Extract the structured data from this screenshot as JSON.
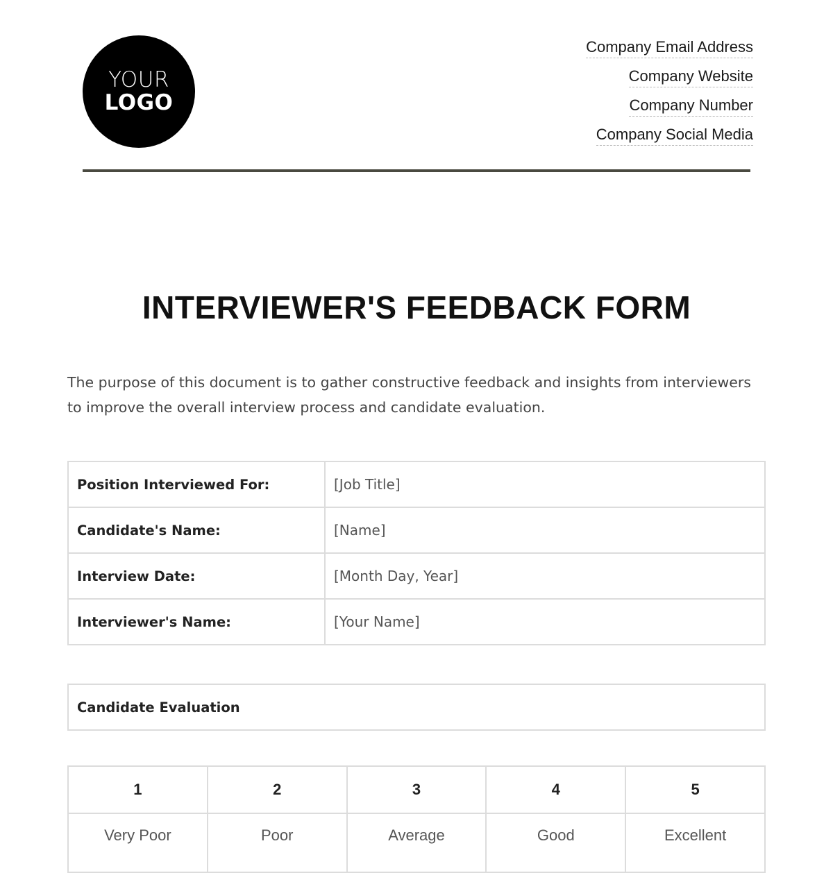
{
  "header": {
    "logo": {
      "line1": "YOUR",
      "line2": "LOGO"
    },
    "contact": [
      "Company Email Address",
      "Company Website",
      "Company Number",
      "Company Social Media"
    ]
  },
  "title": "INTERVIEWER'S FEEDBACK FORM",
  "intro": "The purpose of this document is to gather constructive feedback and insights from interviewers to improve the overall interview process and candidate evaluation.",
  "info_table": [
    {
      "label": "Position Interviewed For:",
      "value": "[Job Title]"
    },
    {
      "label": "Candidate's Name:",
      "value": "[Name]"
    },
    {
      "label": "Interview Date:",
      "value": "[Month Day, Year]"
    },
    {
      "label": "Interviewer's Name:",
      "value": "[Your Name]"
    }
  ],
  "evaluation": {
    "heading": "Candidate Evaluation"
  },
  "rating_scale": {
    "numbers": [
      "1",
      "2",
      "3",
      "4",
      "5"
    ],
    "labels": [
      "Very Poor",
      "Poor",
      "Average",
      "Good",
      "Excellent"
    ]
  }
}
